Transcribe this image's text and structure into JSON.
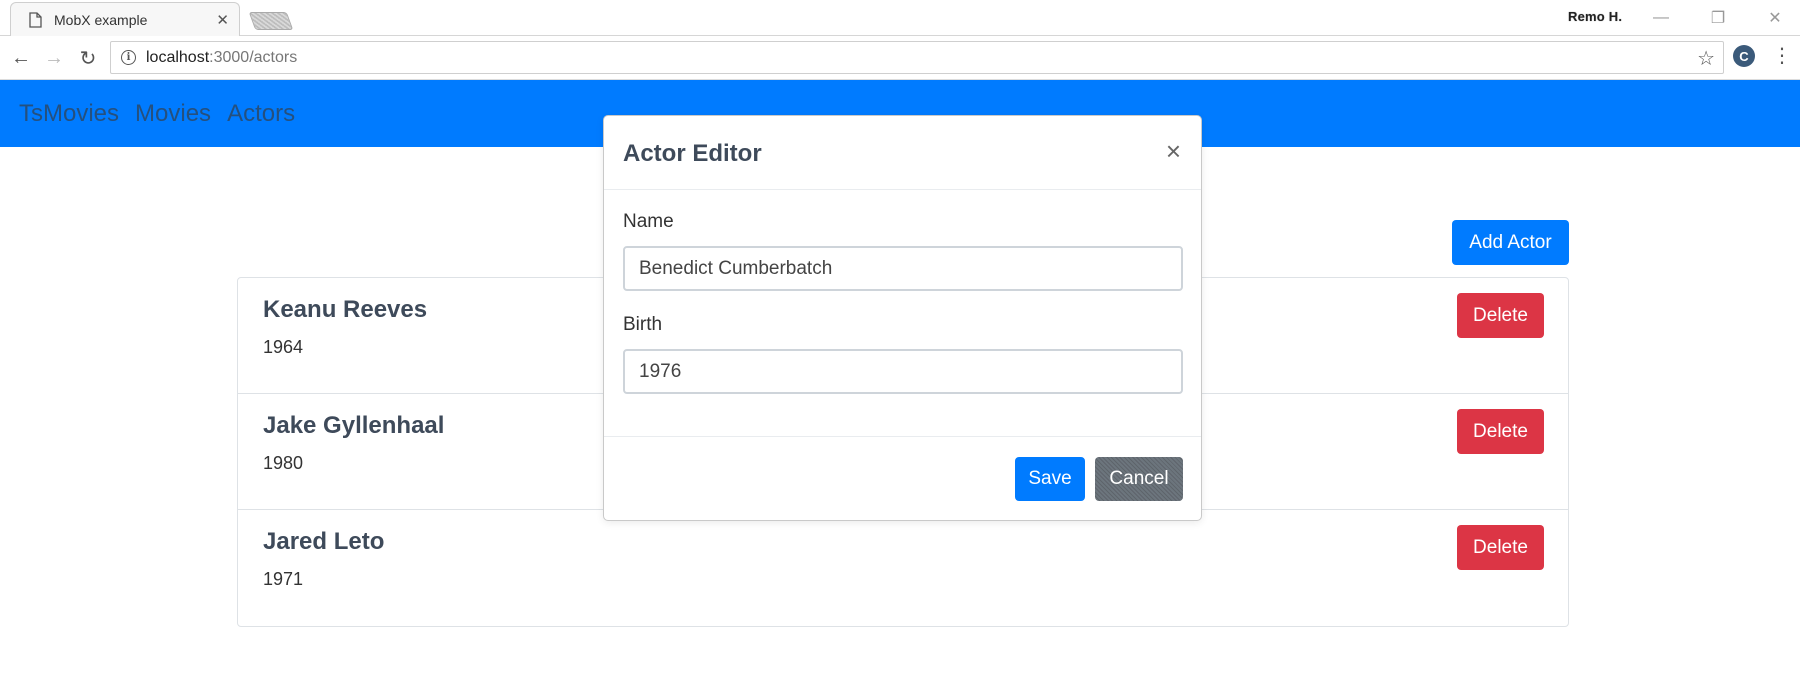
{
  "browser": {
    "tab_title": "MobX example",
    "tab_close": "✕",
    "profile_name": "Remo H.",
    "window_controls": {
      "minimize": "—",
      "restore": "❐",
      "close": "✕"
    },
    "nav": {
      "back": "←",
      "forward": "→",
      "reload": "↻"
    },
    "url_host": "localhost",
    "url_rest": ":3000/actors",
    "star": "☆",
    "menu": "⋮",
    "ext_letter": "C"
  },
  "navbar": {
    "brand": "TsMovies",
    "links": [
      "Movies",
      "Actors"
    ]
  },
  "actions": {
    "add_actor": "Add Actor"
  },
  "actors": [
    {
      "name": "Keanu Reeves",
      "birth": "1964",
      "delete_label": "Delete"
    },
    {
      "name": "Jake Gyllenhaal",
      "birth": "1980",
      "delete_label": "Delete"
    },
    {
      "name": "Jared Leto",
      "birth": "1971",
      "delete_label": "Delete"
    }
  ],
  "modal": {
    "title": "Actor Editor",
    "close": "×",
    "name_label": "Name",
    "name_value": "Benedict Cumberbatch",
    "birth_label": "Birth",
    "birth_value": "1976",
    "save_label": "Save",
    "cancel_label": "Cancel"
  },
  "colors": {
    "primary": "#007bff",
    "danger": "#dc3545",
    "secondary": "#6c757d"
  }
}
